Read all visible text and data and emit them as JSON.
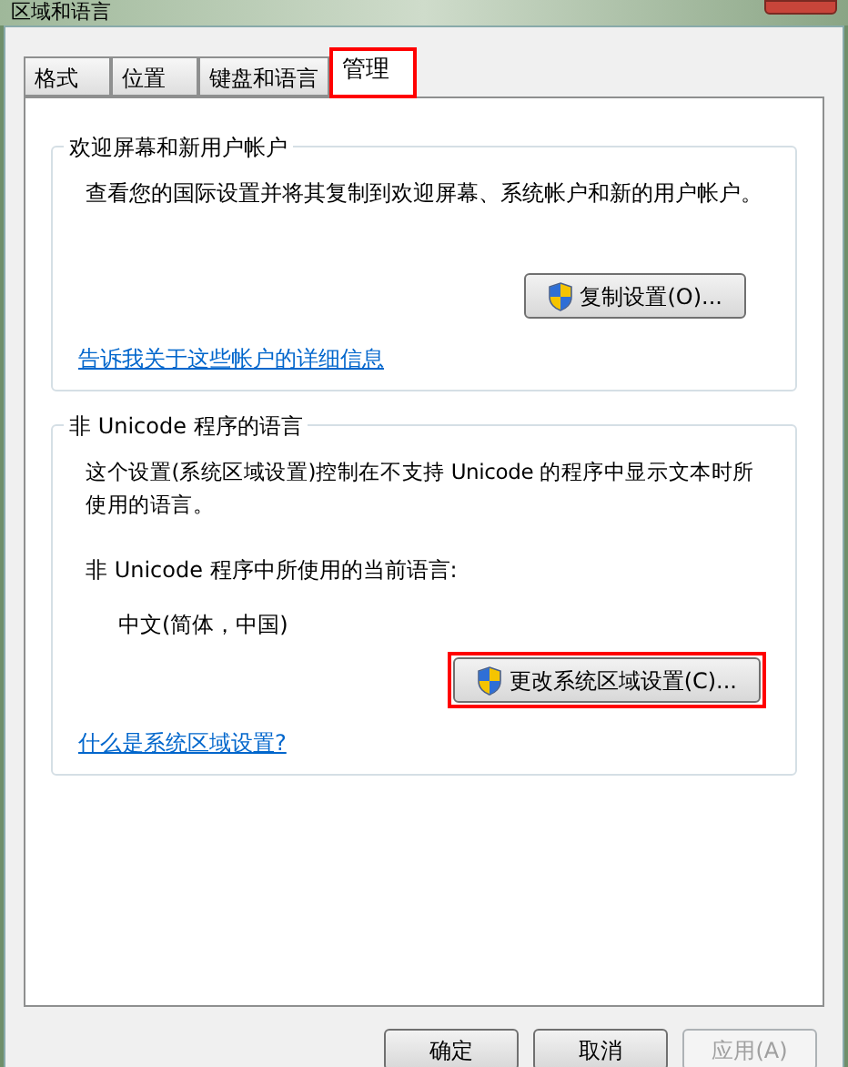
{
  "window": {
    "title": "区域和语言"
  },
  "tabs": [
    {
      "label": "格式",
      "selected": false,
      "highlighted": false
    },
    {
      "label": "位置",
      "selected": false,
      "highlighted": false
    },
    {
      "label": "键盘和语言",
      "selected": false,
      "highlighted": false
    },
    {
      "label": "管理",
      "selected": true,
      "highlighted": true
    }
  ],
  "welcome_group": {
    "title": "欢迎屏幕和新用户帐户",
    "description": "查看您的国际设置并将其复制到欢迎屏幕、系统帐户和新的用户帐户。",
    "button": {
      "label": "复制设置(O)...",
      "highlighted": false
    },
    "link": "告诉我关于这些帐户的详细信息"
  },
  "unicode_group": {
    "title": "非 Unicode 程序的语言",
    "description": "这个设置(系统区域设置)控制在不支持 Unicode 的程序中显示文本时所使用的语言。",
    "current_label": "非 Unicode 程序中所使用的当前语言:",
    "current_value": "中文(简体，中国)",
    "button": {
      "label": "更改系统区域设置(C)...",
      "highlighted": true
    },
    "link": "什么是系统区域设置?"
  },
  "buttons": [
    {
      "label": "确定",
      "disabled": false
    },
    {
      "label": "取消",
      "disabled": false
    },
    {
      "label": "应用(A)",
      "disabled": true
    }
  ]
}
